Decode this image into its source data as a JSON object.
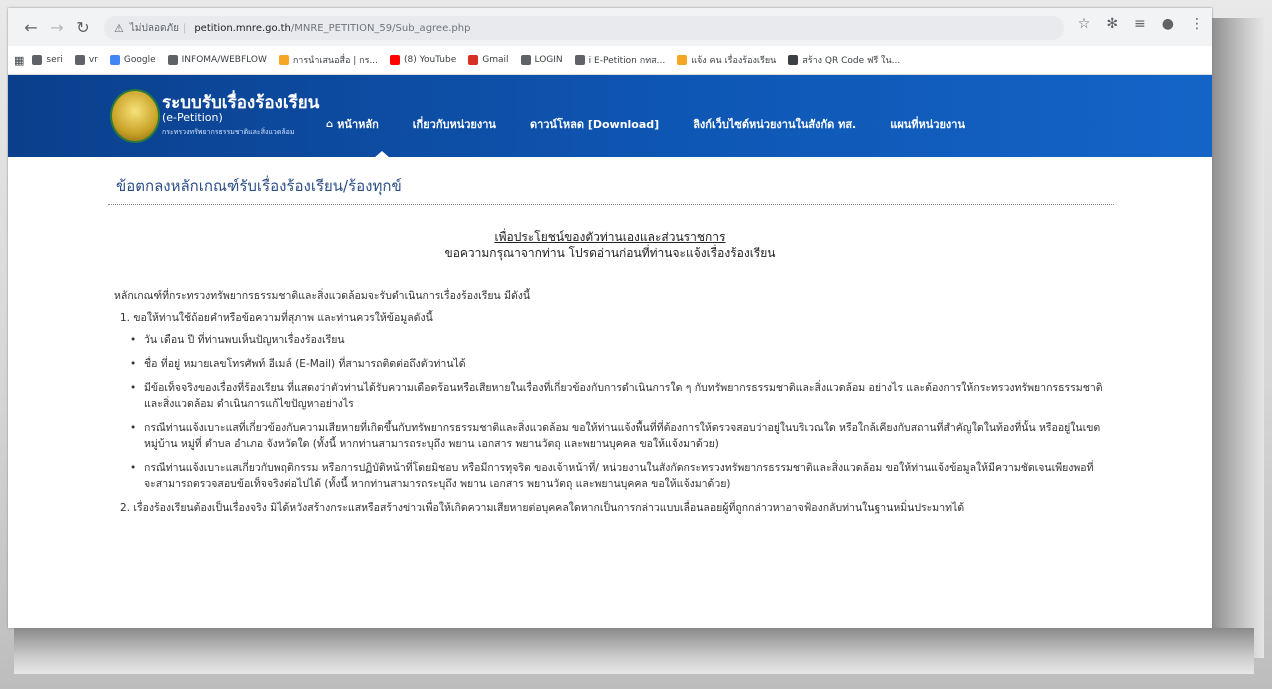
{
  "browser": {
    "security_label": "ไม่ปลอดภัย",
    "url_host": "petition.mnre.go.th",
    "url_path": "/MNRE_PETITION_59/Sub_agree.php",
    "bookmarks": [
      {
        "label": "seri",
        "color": "#5f6368"
      },
      {
        "label": "vr",
        "color": "#5f6368"
      },
      {
        "label": "Google",
        "color": "#4285f4"
      },
      {
        "label": "INFOMA/WEBFLOW",
        "color": "#5f6368"
      },
      {
        "label": "การนำเสนอสื่อ | กร...",
        "color": "#f5a623"
      },
      {
        "label": "(8) YouTube",
        "color": "#ff0000"
      },
      {
        "label": "Gmail",
        "color": "#d93025"
      },
      {
        "label": "LOGIN",
        "color": "#5f6368"
      },
      {
        "label": "i E-Petition กทส...",
        "color": "#5f6368"
      },
      {
        "label": "แจ้ง คน เรื่องร้องเรียน",
        "color": "#f5a623"
      },
      {
        "label": "สร้าง QR Code ฟรี ใน...",
        "color": "#3c4043"
      }
    ]
  },
  "site": {
    "title": "ระบบรับเรื่องร้องเรียน",
    "subtitle": "(e-Petition)",
    "tagline": "กระทรวงทรัพยากรธรรมชาติและสิ่งแวดล้อม",
    "nav": [
      {
        "label": "หน้าหลัก"
      },
      {
        "label": "เกี่ยวกับหน่วยงาน"
      },
      {
        "label": "ดาวน์โหลด [Download]"
      },
      {
        "label": "ลิงก์เว็บไซต์หน่วยงานในสังกัด ทส."
      },
      {
        "label": "แผนที่หน่วยงาน"
      }
    ]
  },
  "content": {
    "heading": "ข้อตกลงหลักเกณฑ์รับเรื่องร้องเรียน/ร้องทุกข์",
    "notice_line1": "เพื่อประโยชน์ของตัวท่านเองและส่วนราชการ",
    "notice_line2": "ขอความกรุณาจากท่าน โปรดอ่านก่อนที่ท่านจะแจ้งเรื่องร้องเรียน",
    "intro": "หลักเกณฑ์ที่กระทรวงทรัพยากรธรรมชาติและสิ่งแวดล้อมจะรับดำเนินการเรื่องร้องเรียน มีดังนี้",
    "rule1": "1. ขอให้ท่านใช้ถ้อยคำหรือข้อความที่สุภาพ และท่านควรให้ข้อมูลดังนี้",
    "bullets": [
      "วัน เดือน ปี ที่ท่านพบเห็นปัญหาเรื่องร้องเรียน",
      "ชื่อ ที่อยู่ หมายเลขโทรศัพท์ อีเมล์ (E-Mail) ที่สามารถติดต่อถึงตัวท่านได้",
      "มีข้อเท็จจริงของเรื่องที่ร้องเรียน ที่แสดงว่าตัวท่านได้รับความเดือดร้อนหรือเสียหายในเรื่องที่เกี่ยวข้องกับการดำเนินการใด ๆ กับทรัพยากรธรรมชาติและสิ่งแวดล้อม อย่างไร และต้องการให้กระทรวงทรัพยากรธรรมชาติและสิ่งแวดล้อม ดำเนินการแก้ไขปัญหาอย่างไร",
      "กรณีท่านแจ้งเบาะแสที่เกี่ยวข้องกับความเสียหายที่เกิดขึ้นกับทรัพยากรธรรมชาติและสิ่งแวดล้อม ขอให้ท่านแจ้งพื้นที่ที่ต้องการให้ตรวจสอบว่าอยู่ในบริเวณใด หรือใกล้เคียงกับสถานที่สำคัญใดในท้องที่นั้น หรืออยู่ในเขตหมู่บ้าน หมู่ที่ ตำบล อำเภอ จังหวัดใด (ทั้งนี้ หากท่านสามารถระบุถึง พยาน เอกสาร พยานวัตถุ และพยานบุคคล ขอให้แจ้งมาด้วย)",
      "กรณีท่านแจ้งเบาะแสเกี่ยวกับพฤติกรรม หรือการปฏิบัติหน้าที่โดยมิชอบ หรือมีการทุจริต ของเจ้าหน้าที่/ หน่วยงานในสังกัดกระทรวงทรัพยากรธรรมชาติและสิ่งแวดล้อม ขอให้ท่านแจ้งข้อมูลให้มีความชัดเจนเพียงพอที่จะสามารถตรวจสอบข้อเท็จจริงต่อไปได้ (ทั้งนี้ หากท่านสามารถระบุถึง พยาน เอกสาร พยานวัตถุ และพยานบุคคล ขอให้แจ้งมาด้วย)"
    ],
    "rule2": "2. เรื่องร้องเรียนต้องเป็นเรื่องจริง มิได้หวังสร้างกระแสหรือสร้างข่าวเพื่อให้เกิดความเสียหายต่อบุคคลใดหากเป็นการกล่าวแบบเลื่อนลอยผู้ที่ถูกกล่าวหาอาจฟ้องกลับท่านในฐานหมิ่นประมาทได้"
  }
}
